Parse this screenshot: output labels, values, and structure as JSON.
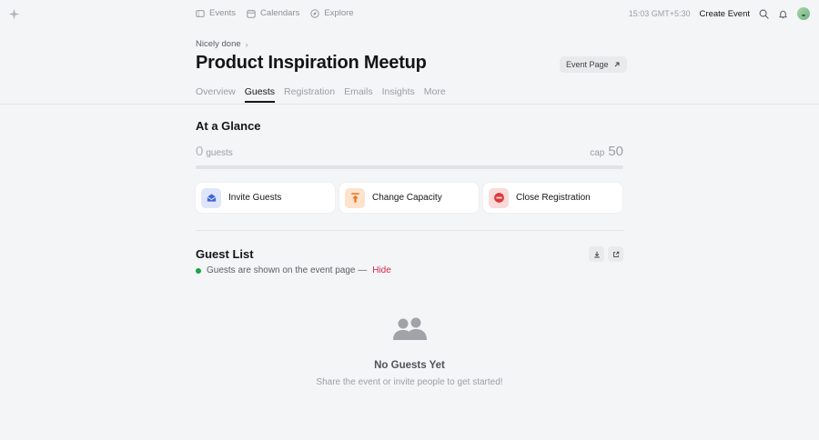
{
  "nav": {
    "links": [
      {
        "label": "Events",
        "icon": "ticket-icon"
      },
      {
        "label": "Calendars",
        "icon": "calendar-icon"
      },
      {
        "label": "Explore",
        "icon": "compass-icon"
      }
    ],
    "time": "15:03 GMT+5:30",
    "create_label": "Create Event"
  },
  "header": {
    "breadcrumb": "Nicely done",
    "title": "Product Inspiration Meetup",
    "event_page_label": "Event Page"
  },
  "tabs": [
    "Overview",
    "Guests",
    "Registration",
    "Emails",
    "Insights",
    "More"
  ],
  "active_tab": "Guests",
  "glance": {
    "title": "At a Glance",
    "guest_count": "0",
    "guest_unit": "guests",
    "cap_label": "cap",
    "cap_value": "50",
    "fill_fraction": 0
  },
  "actions": [
    {
      "label": "Invite Guests",
      "icon": "envelope-icon",
      "color": "#3f66d8"
    },
    {
      "label": "Change Capacity",
      "icon": "upload-arrow-icon",
      "color": "#e8741e"
    },
    {
      "label": "Close Registration",
      "icon": "no-entry-icon",
      "color": "#d93b3b"
    }
  ],
  "guest_list": {
    "title": "Guest List",
    "visibility_text": "Guests are shown on the event page —",
    "hide_label": "Hide",
    "status_color": "#1aa34a"
  },
  "empty": {
    "title": "No Guests Yet",
    "subtitle": "Share the event or invite people to get started!"
  }
}
